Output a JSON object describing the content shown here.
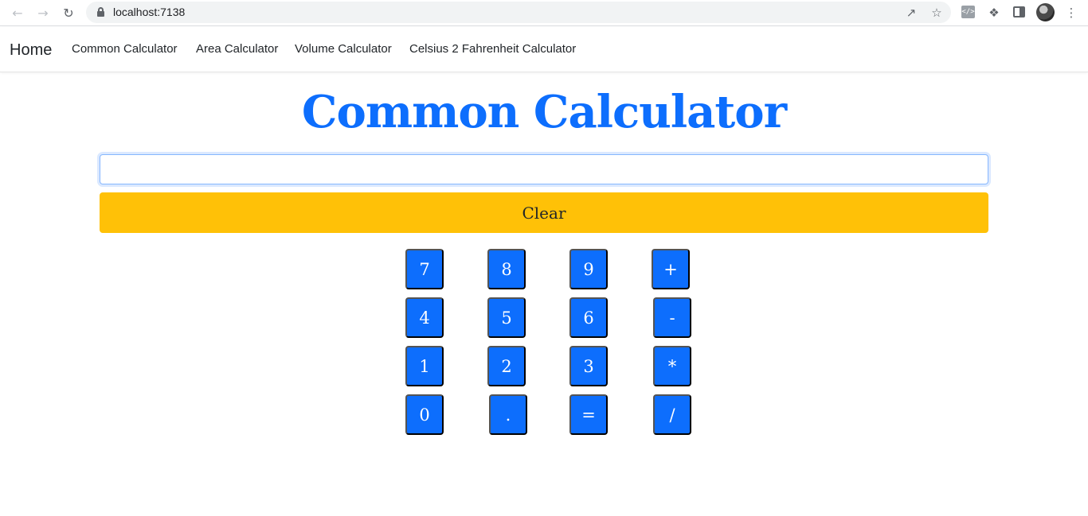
{
  "browser": {
    "back_icon": "arrow-left-icon",
    "forward_icon": "arrow-right-icon",
    "reload_icon": "reload-icon",
    "url": "localhost:7138",
    "devtools_label": "</>"
  },
  "navbar": {
    "brand": "Home",
    "links": [
      {
        "label": "Common Calculator"
      },
      {
        "label": "Area Calculator"
      },
      {
        "label": "Volume Calculator"
      },
      {
        "label": "Celsius 2 Fahrenheit Calculator"
      }
    ]
  },
  "main": {
    "title": "Common Calculator",
    "display_value": "",
    "clear_label": "Clear",
    "keys": [
      {
        "label": "7"
      },
      {
        "label": "8"
      },
      {
        "label": "9"
      },
      {
        "label": "+"
      },
      {
        "label": "4"
      },
      {
        "label": "5"
      },
      {
        "label": "6"
      },
      {
        "label": "-"
      },
      {
        "label": "1"
      },
      {
        "label": "2"
      },
      {
        "label": "3"
      },
      {
        "label": "*"
      },
      {
        "label": "0"
      },
      {
        "label": "."
      },
      {
        "label": "="
      },
      {
        "label": "/"
      }
    ]
  },
  "colors": {
    "primary": "#0d6efd",
    "warning": "#ffc107",
    "text": "#212529"
  }
}
